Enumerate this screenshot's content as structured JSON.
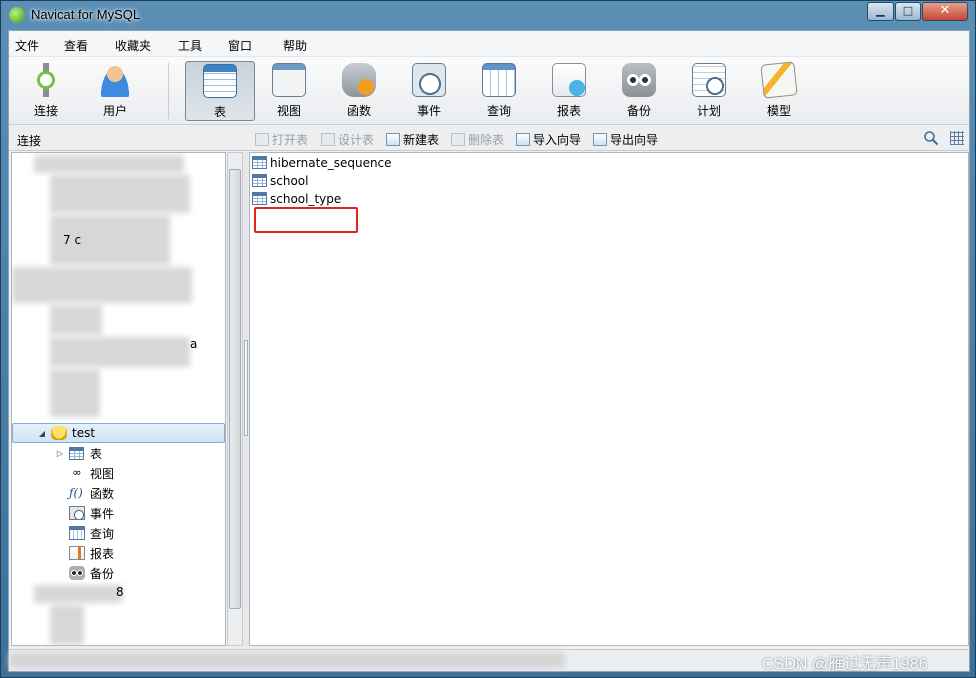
{
  "window": {
    "title": "Navicat for MySQL",
    "minimize_label": "▁",
    "maximize_label": "□",
    "close_label": "✕"
  },
  "menu": [
    "文件",
    "查看",
    "收藏夹",
    "工具",
    "窗口",
    "帮助"
  ],
  "toolbar": {
    "items": [
      {
        "label": "连接",
        "icon": "connection-icon"
      },
      {
        "label": "用户",
        "icon": "user-icon"
      },
      {
        "label": "表",
        "icon": "table-icon",
        "active": true
      },
      {
        "label": "视图",
        "icon": "view-icon"
      },
      {
        "label": "函数",
        "icon": "function-icon"
      },
      {
        "label": "事件",
        "icon": "event-icon"
      },
      {
        "label": "查询",
        "icon": "query-icon"
      },
      {
        "label": "报表",
        "icon": "report-icon"
      },
      {
        "label": "备份",
        "icon": "backup-icon"
      },
      {
        "label": "计划",
        "icon": "schedule-icon"
      },
      {
        "label": "模型",
        "icon": "model-icon"
      }
    ]
  },
  "subbar": {
    "connection_label": "连接",
    "actions": [
      {
        "label": "打开表",
        "enabled": false
      },
      {
        "label": "设计表",
        "enabled": false
      },
      {
        "label": "新建表",
        "enabled": true
      },
      {
        "label": "删除表",
        "enabled": false
      },
      {
        "label": "导入向导",
        "enabled": true
      },
      {
        "label": "导出向导",
        "enabled": true
      }
    ]
  },
  "tree": {
    "database": "test",
    "children": [
      "表",
      "视图",
      "函数",
      "事件",
      "查询",
      "报表",
      "备份"
    ],
    "partial_text": {
      "a": "a",
      "b": "8",
      "c": "7 c"
    }
  },
  "tables": [
    "hibernate_sequence",
    "school",
    "school_type"
  ],
  "watermark": "CSDN @雁过无声1986",
  "colors": {
    "highlight": "#e0241b",
    "title_bar": "#4a7da4",
    "selection": "#cfe4f7"
  }
}
